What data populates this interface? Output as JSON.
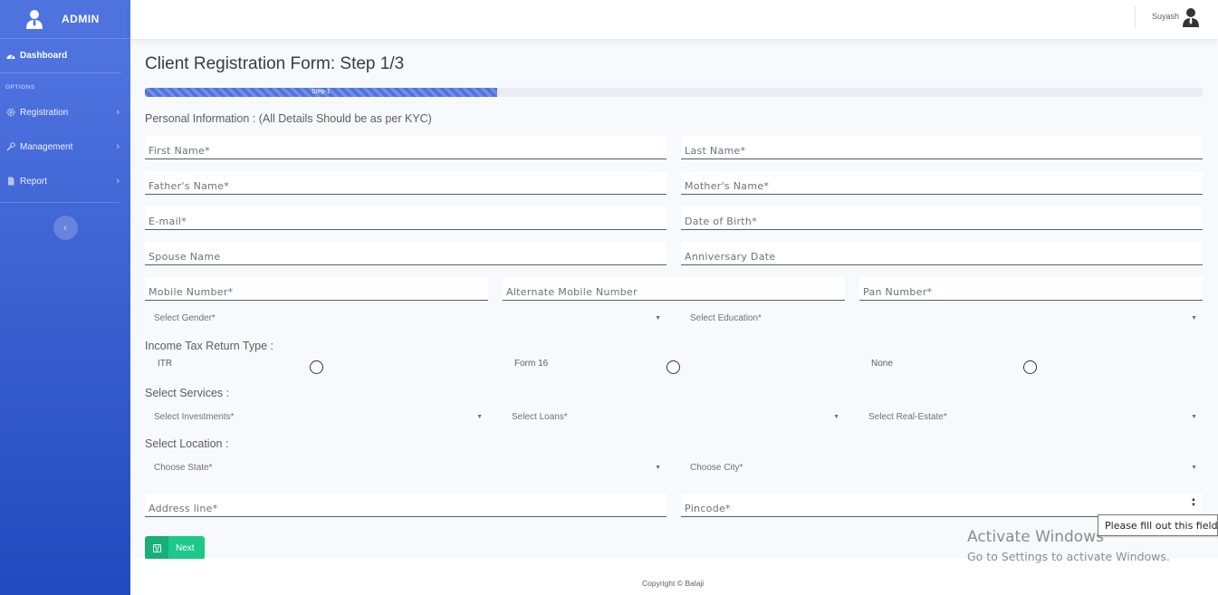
{
  "sidebar": {
    "brand": "ADMIN",
    "dashboard_label": "Dashboard",
    "section_label": "OPTIONS",
    "items": [
      {
        "label": "Registration",
        "icon": "gear-icon"
      },
      {
        "label": "Management",
        "icon": "wrench-icon"
      },
      {
        "label": "Report",
        "icon": "file-icon"
      }
    ],
    "toggle_glyph": "‹",
    "chevron_glyph": "›"
  },
  "topbar": {
    "username": "Suyash"
  },
  "form": {
    "title": "Client Registration Form: Step 1/3",
    "progress": {
      "label": "Step-1",
      "percent": 33.3
    },
    "personal_heading": "Personal Information : (All Details Should be as per KYC)",
    "first_name": "First Name*",
    "last_name": "Last Name*",
    "fathers_name": "Father's Name*",
    "mothers_name": "Mother's Name*",
    "email": "E-mail*",
    "dob": "Date of Birth*",
    "spouse_name": "Spouse Name",
    "anniversary_date": "Anniversary Date",
    "mobile": "Mobile Number*",
    "alt_mobile": "Alternate Mobile Number",
    "pan": "Pan Number*",
    "gender": "Select Gender*",
    "education": "Select Education*",
    "itr_heading": "Income Tax Return Type :",
    "itr_options": [
      "ITR",
      "Form 16",
      "None"
    ],
    "services_heading": "Select Services :",
    "investments": "Select Investments*",
    "loans": "Select Loans*",
    "real_estate": "Select Real-Estate*",
    "location_heading": "Select Location :",
    "state": "Choose State*",
    "city": "Choose City*",
    "address": "Address line*",
    "pincode": "Pincode*",
    "next_label": "Next",
    "caret_glyph": "▼"
  },
  "footer": {
    "copyright": "Copyright © Balaji"
  },
  "overlay": {
    "tooltip": "Please fill out this field.",
    "activate_title": "Activate Windows",
    "activate_sub": "Go to Settings to activate Windows."
  },
  "colors": {
    "primary": "#4e73df",
    "primary_dark": "#224abe",
    "success": "#1cc88a"
  }
}
